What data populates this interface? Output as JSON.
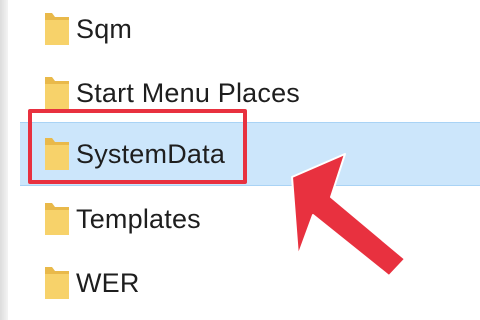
{
  "file_list": {
    "items": [
      {
        "label": "Sqm",
        "icon": "folder-icon",
        "selected": false
      },
      {
        "label": "Start Menu Places",
        "icon": "folder-icon",
        "selected": false
      },
      {
        "label": "SystemData",
        "icon": "folder-icon",
        "selected": true
      },
      {
        "label": "Templates",
        "icon": "folder-icon",
        "selected": false
      },
      {
        "label": "WER",
        "icon": "folder-icon",
        "selected": false
      }
    ]
  },
  "annotation": {
    "highlighted_item": "SystemData",
    "box_color": "#e8313f",
    "arrow_color": "#e8313f",
    "arrow_icon": "pointer-arrow-icon"
  },
  "colors": {
    "selection_background": "#cce6fb",
    "folder_yellow": "#f7d26a"
  }
}
